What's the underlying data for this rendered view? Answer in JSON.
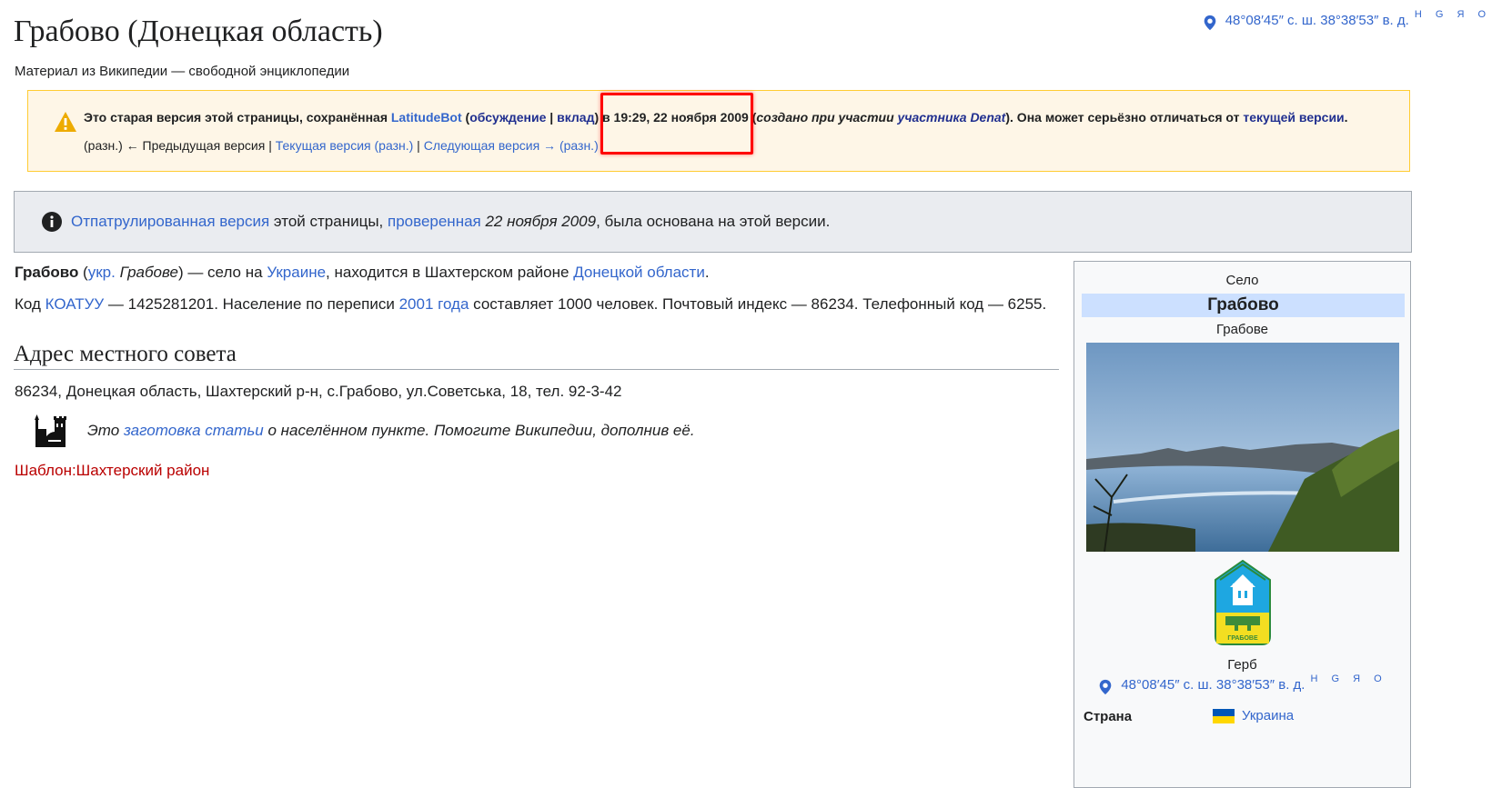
{
  "title": "Грабово (Донецкая область)",
  "subtitle": "Материал из Википедии — свободной энциклопедии",
  "coords": {
    "text": "48°08′45″ с. ш. 38°38′53″ в. д.",
    "links": "H G Я O"
  },
  "old_version": {
    "p1": "Это старая версия этой страницы, сохранённая ",
    "user": "LatitudeBot",
    "p2": " (",
    "talk": "обсуждение",
    "sep": " | ",
    "contrib": "вклад",
    "p3": ") в ",
    "datetime": "19:29, 22 ноября 2009",
    "p4": " (",
    "created_by": "создано при участии ",
    "participant": "участника Denat",
    "p5": "). Она может серьёзно отличаться от ",
    "current": "текущей версии",
    "p6": ".",
    "nav_diff1": "(разн.)",
    "nav_prev": " ← Предыдущая версия | ",
    "nav_current": "Текущая версия",
    "nav_diff2": "(разн.)",
    "nav_sep": " | ",
    "nav_next": "Следующая версия →",
    "nav_diff3": "(разн.)"
  },
  "patrol": {
    "link1": "Отпатрулированная версия",
    "t1": " этой страницы, ",
    "link2": "проверенная",
    "date": " 22 ноября 2009",
    "t2": ", была основана на этой версии."
  },
  "intro": {
    "name": "Грабово",
    "t1": " (",
    "ukr": "укр.",
    "ukr_name": " Грабове",
    "t2": ") — село на ",
    "ukraine": "Украине",
    "t3": ", находится в Шахтерском районе ",
    "oblast": "Донецкой области",
    "t4": "."
  },
  "codes": {
    "t1": "Код ",
    "koatuu": "КОАТУУ",
    "t2": " — 1425281201. Население по переписи ",
    "year": "2001 года",
    "t3": " составляет 1000 человек. Почтовый индекс — 86234. Телефонный код — 6255."
  },
  "section_heading": "Адрес местного совета",
  "address": "86234, Донецкая область, Шахтерский р-н, с.Грабово, ул.Советська, 18, тел. 92-3-42",
  "stub": {
    "t1": "Это ",
    "link1": "заготовка",
    "t2": " ",
    "link2": "статьи",
    "t3": " о населённом пункте. Помогите Википедии, дополнив её."
  },
  "template_link": "Шаблон:Шахтерский район",
  "infobox": {
    "type": "Село",
    "name": "Грабово",
    "local_name": "Грабове",
    "coat_caption": "Герб",
    "coat_text": "ГРАБОВЕ",
    "country_label": "Страна",
    "country_value": "Украина"
  },
  "icons": {
    "location": "map-pin-icon",
    "warning": "warning-triangle-icon",
    "info": "info-circle-icon",
    "stub": "city-buildings-icon",
    "flag": "ukraine-flag-icon"
  },
  "colors": {
    "link": "#3366cc",
    "visited_link": "#202f8f",
    "red_link": "#ba0000",
    "warning_bg": "#fef6e7",
    "warning_border": "#ffcc33",
    "infobox_title_bg": "#cce0ff",
    "highlight": "#ff0000"
  }
}
